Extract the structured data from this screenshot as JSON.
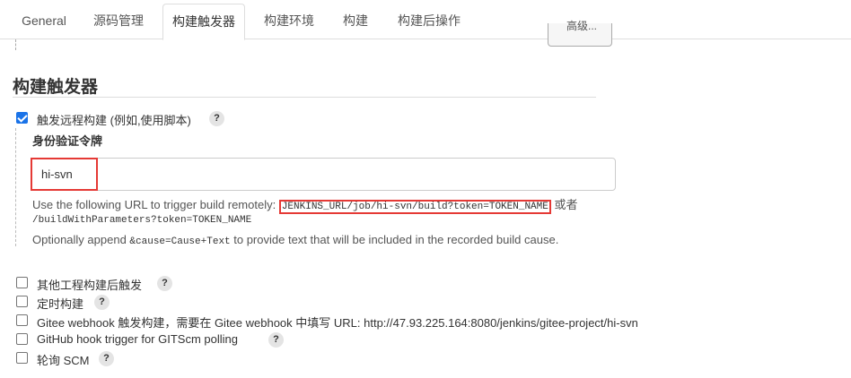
{
  "tabs": [
    "General",
    "源码管理",
    "构建触发器",
    "构建环境",
    "构建",
    "构建后操作"
  ],
  "prev_button_label": "高级...",
  "section": {
    "title": "构建触发器"
  },
  "remote_trigger": {
    "checked": true,
    "label": "触发远程构建 (例如,使用脚本)",
    "help": "?",
    "token_label": "身份验证令牌",
    "token_value": "hi-svn",
    "help_line1_prefix": "Use the following URL to trigger build remotely: ",
    "help_url": "JENKINS_URL/job/hi-svn/build?token=TOKEN_NAME",
    "help_line1_suffix": " 或者",
    "help_line2": "/buildWithParameters?token=TOKEN_NAME",
    "help_line3_prefix": "Optionally append ",
    "help_line3_code": "&cause=Cause+Text",
    "help_line3_suffix": " to provide text that will be included in the recorded build cause."
  },
  "other_triggers": [
    {
      "label": "其他工程构建后触发",
      "help": "?",
      "checked": false
    },
    {
      "label": "定时构建",
      "help": "?",
      "checked": false
    },
    {
      "label": "Gitee webhook 触发构建，需要在 Gitee webhook 中填写 URL: http://47.93.225.164:8080/jenkins/gitee-project/hi-svn",
      "help": "",
      "checked": false
    },
    {
      "label": "GitHub hook trigger for GITScm polling",
      "help": "?",
      "checked": false
    },
    {
      "label": "轮询 SCM",
      "help": "?",
      "checked": false
    }
  ],
  "colors": {
    "accent": "#1a73e8",
    "highlight": "#e53935"
  }
}
